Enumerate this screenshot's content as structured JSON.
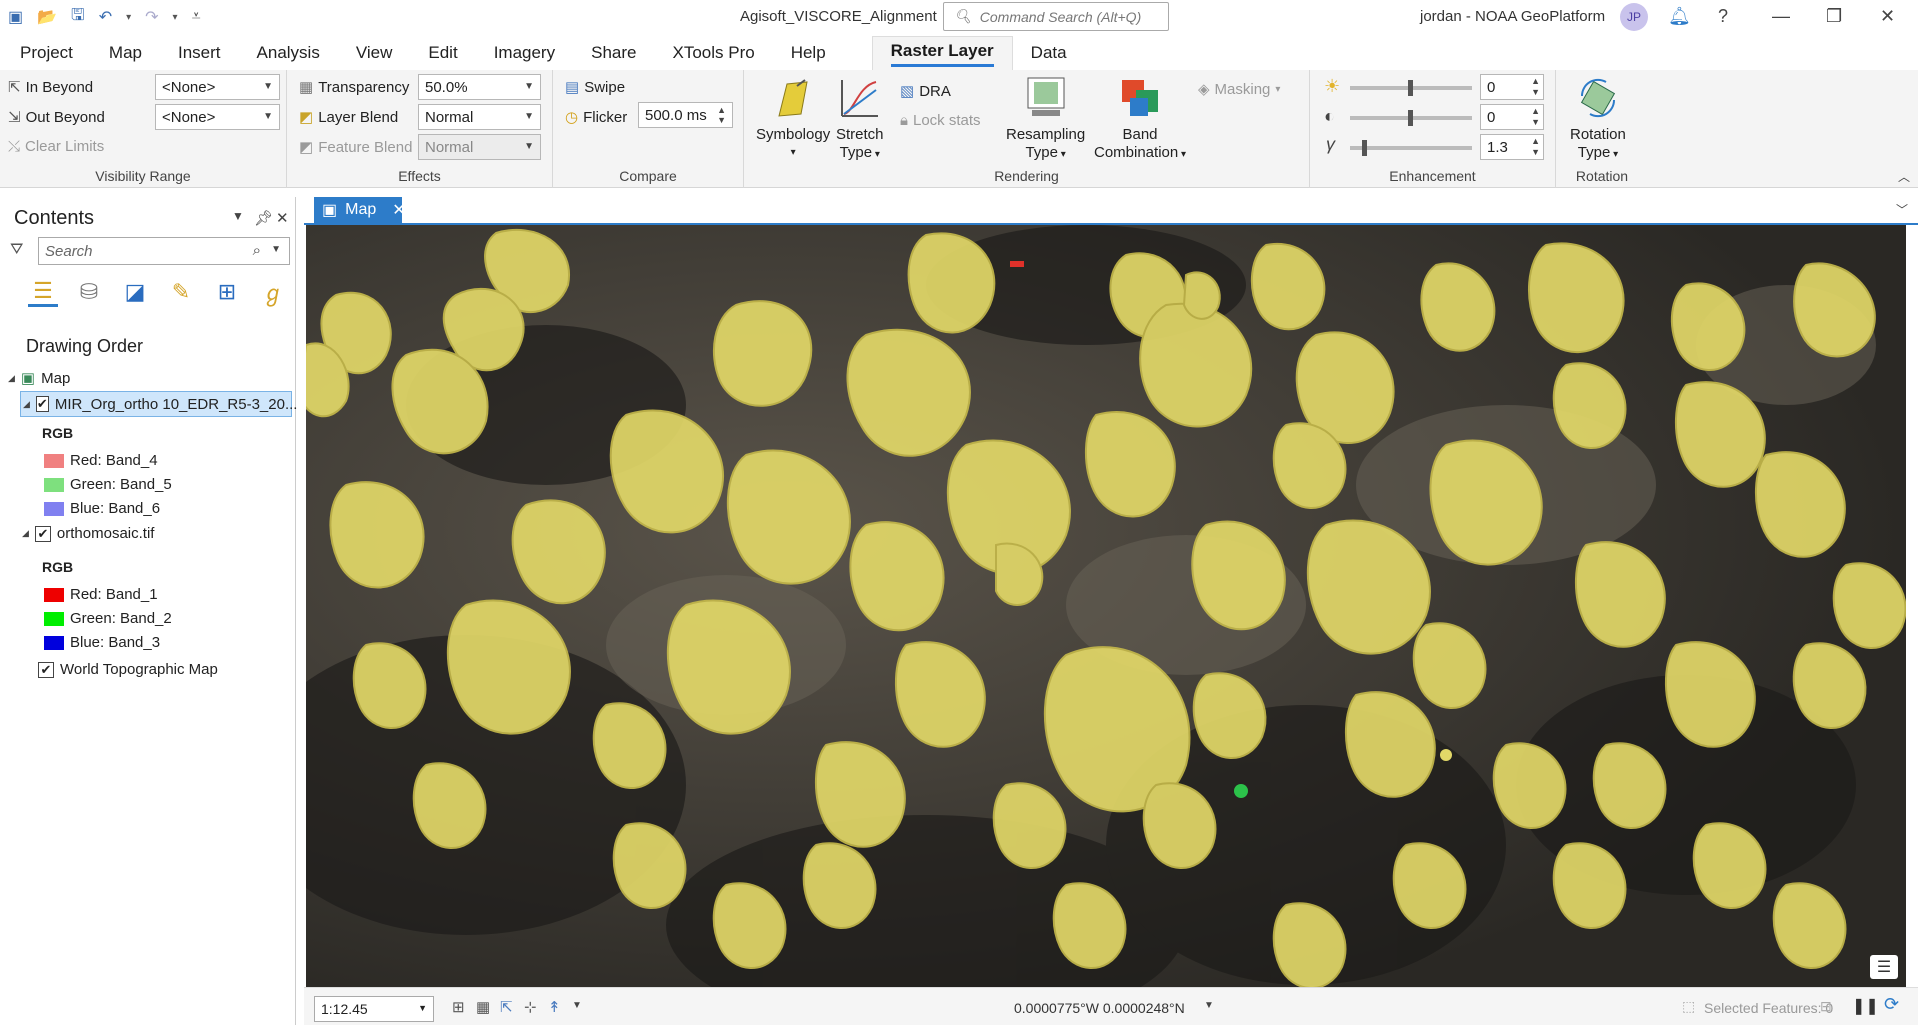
{
  "titlebar": {
    "app_title": "Agisoft_VISCORE_Alignment",
    "command_search_placeholder": "Command Search (Alt+Q)",
    "user": "jordan - NOAA GeoPlatform",
    "avatar_initials": "JP"
  },
  "menus": [
    "Project",
    "Map",
    "Insert",
    "Analysis",
    "View",
    "Edit",
    "Imagery",
    "Share",
    "XTools Pro",
    "Help",
    "Raster Layer",
    "Data"
  ],
  "active_menu": "Raster Layer",
  "ribbon": {
    "visibility_range": {
      "label": "Visibility Range",
      "in_beyond": "In Beyond",
      "out_beyond": "Out Beyond",
      "clear_limits": "Clear Limits",
      "in_value": "<None>",
      "out_value": "<None>"
    },
    "effects": {
      "label": "Effects",
      "transparency": "Transparency",
      "transparency_value": "50.0%",
      "layer_blend": "Layer Blend",
      "layer_blend_value": "Normal",
      "feature_blend": "Feature Blend",
      "feature_blend_value": "Normal"
    },
    "compare": {
      "label": "Compare",
      "swipe": "Swipe",
      "flicker": "Flicker",
      "flicker_value": "500.0",
      "flicker_unit": "ms"
    },
    "rendering": {
      "label": "Rendering",
      "symbology": "Symbology",
      "stretch_type_1": "Stretch",
      "stretch_type_2": "Type",
      "dra": "DRA",
      "lock_stats": "Lock stats",
      "resampling_1": "Resampling",
      "resampling_2": "Type",
      "band_combo_1": "Band",
      "band_combo_2": "Combination",
      "masking": "Masking"
    },
    "enhancement": {
      "label": "Enhancement",
      "brightness": "0",
      "contrast": "0",
      "gamma": "1.3"
    },
    "rotation": {
      "label": "Rotation",
      "rotation_type_1": "Rotation",
      "rotation_type_2": "Type"
    }
  },
  "contents": {
    "title": "Contents",
    "search_placeholder": "Search",
    "drawing_order": "Drawing Order",
    "map_node": "Map",
    "layer1": {
      "name": "MIR_Org_ortho 10_EDR_R5-3_20...",
      "rgb": "RGB",
      "red": "Red:  Band_4",
      "green": "Green:  Band_5",
      "blue": "Blue:  Band_6",
      "red_color": "#f08080",
      "green_color": "#7ee07e",
      "blue_color": "#8080f0"
    },
    "layer2": {
      "name": "orthomosaic.tif",
      "rgb": "RGB",
      "red": "Red:  Band_1",
      "green": "Green:  Band_2",
      "blue": "Blue:  Band_3",
      "red_color": "#ee0000",
      "green_color": "#00ee00",
      "blue_color": "#0000dd"
    },
    "layer3": {
      "name": "World Topographic Map"
    }
  },
  "map": {
    "tab_label": "Map",
    "scale": "1:12.45",
    "coordinates": "0.0000775°W 0.0000248°N",
    "selected_features": "Selected Features: 0"
  },
  "colors": {
    "accent": "#2d7cc9",
    "overlay": "#e6dc6a"
  }
}
